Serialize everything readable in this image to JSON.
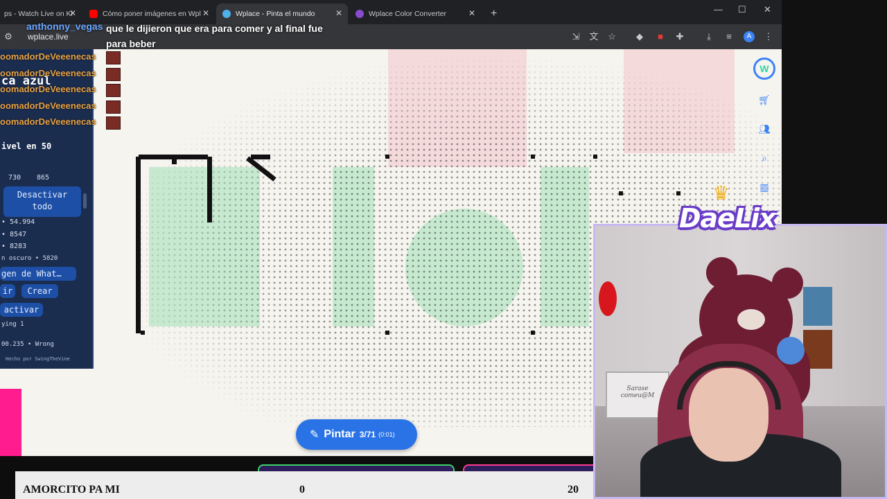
{
  "browser": {
    "tabs": [
      {
        "title": "ps - Watch Live on Ki",
        "favicon_color": "#53fc18",
        "active": false
      },
      {
        "title": "Cómo poner imágenes en Wpl",
        "favicon_color": "#ff0000",
        "active": false
      },
      {
        "title": "Wplace - Pinta el mundo",
        "favicon_color": "#4fb0e8",
        "active": true
      },
      {
        "title": "Wplace Color Converter",
        "favicon_color": "#8a4ad0",
        "active": false
      }
    ],
    "new_tab_icon": "+",
    "url": "wplace.live",
    "window_controls": {
      "minimize": "—",
      "maximize": "☐",
      "close": "✕"
    }
  },
  "chat": {
    "repeat_user": "oomadorDeVeeenecas",
    "repeat_count": 5,
    "latest": {
      "username": "anthonny_vegas",
      "message": "que le dijieron que era para comer y al final fue para beber"
    }
  },
  "panel": {
    "title_fragment": "ca azul",
    "level_text": "ivel en 50",
    "stat_row": [
      "730",
      "865"
    ],
    "deactivate_all": "Desactivar\ntodo",
    "stats": [
      "• 54.994",
      "• 8547",
      "• 8283",
      "n oscuro • 5820"
    ],
    "image_button": "gen de What…",
    "btn_ir": "ir",
    "btn_crear": "Crear",
    "btn_activar": "activar",
    "status": "ying 1",
    "status2": "00.235 • Wrong",
    "credit": "Hecho por SwingTheVine"
  },
  "paint_button": {
    "label": "Pintar",
    "count": "3/71",
    "timer": "(0:01)"
  },
  "goal": {
    "label": "AMORCITO PA MI",
    "current": "0",
    "target": "20"
  },
  "stream": {
    "logo": "DaeLix",
    "sign_text": "Sarase\ncomeu@M"
  },
  "colors": {
    "accent_blue": "#2a73e6",
    "panel_bg": "#1b2d4f",
    "chat_user": "#e8a54a",
    "chat_name": "#6aa6ff",
    "pink": "#ff1c8e"
  }
}
